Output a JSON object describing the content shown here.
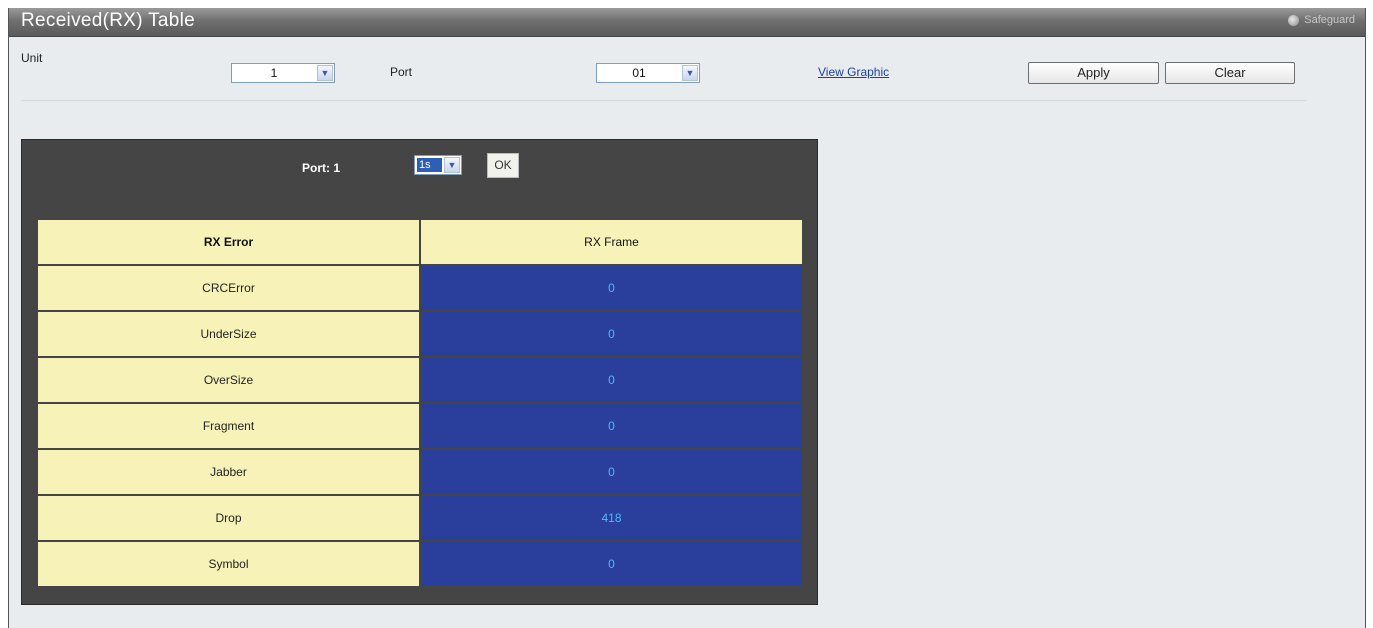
{
  "title": "Received(RX) Table",
  "safeguard": "Safeguard",
  "toolbar": {
    "unit_label": "Unit",
    "unit_value": "1",
    "port_label": "Port",
    "port_value": "01",
    "view_graphic": "View Graphic",
    "apply": "Apply",
    "clear": "Clear"
  },
  "panel": {
    "port_label": "Port: 1",
    "interval_value": "1s",
    "ok": "OK"
  },
  "table": {
    "headers": [
      "RX Error",
      "RX Frame"
    ],
    "rows": [
      {
        "error": "CRCError",
        "frame": "0"
      },
      {
        "error": "UnderSize",
        "frame": "0"
      },
      {
        "error": "OverSize",
        "frame": "0"
      },
      {
        "error": "Fragment",
        "frame": "0"
      },
      {
        "error": "Jabber",
        "frame": "0"
      },
      {
        "error": "Drop",
        "frame": "418"
      },
      {
        "error": "Symbol",
        "frame": "0"
      }
    ]
  },
  "colors": {
    "header_cell": "#f7f3b8",
    "value_cell": "#2a3f9c",
    "value_text": "#4fb6ff",
    "panel_bg": "#454545"
  }
}
